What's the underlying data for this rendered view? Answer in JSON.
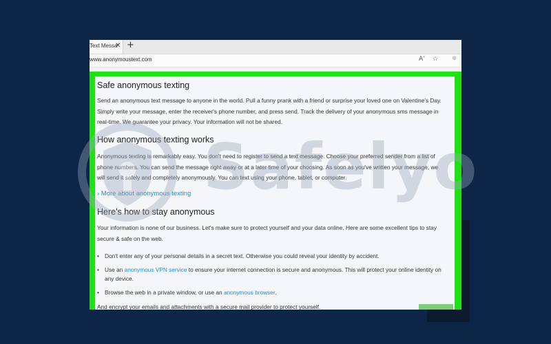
{
  "browser": {
    "tab_title": "Text Messa",
    "tab_close": "✕",
    "new_tab": "+",
    "url": "www.anonymoustext.com",
    "read_aloud_icon": "Aʼ",
    "favorite_icon": "☆",
    "profile_icon": "⌾"
  },
  "page": {
    "h1": "Safe anonymous texting",
    "p1": "Send an anonymous text message to anyone in the world. Pull a funny prank with a friend or surprise your loved one on Valentine's Day. Simply write your message, enter the receiver's phone number, and press send. Track the delivery of your anonymous sms message in real-time. We guarantee your privacy. Your information will not be shared.",
    "h2": "How anonymous texting works",
    "p2": "Anonymous texting is remarkably easy. You don't need to register to send a text message. Choose your preferred sender from a list of phone numbers. You can send the message right away or at a later time of your choosing. As soon as you've written your message, we will send it safely and completely anonymously. You can text using your phone, tablet, or computer.",
    "more_link": "› More about anonymous texting",
    "h3": "Here's how to stay anonymous",
    "p3": "Your information is none of our business. Let's make sure to protect yourself and your data online. Here are some excellent tips to stay secure & safe on the web.",
    "bullet_symbol": "•",
    "bullet1": "Don't enter any of your personal details in a secret text. Otherwise you could reveal your identity by accident.",
    "bullet2_pre": "Use an ",
    "bullet2_link": "anonymous VPN service",
    "bullet2_post": " to ensure your internet connection is secure and anonymous. This will protect your online identity on any device.",
    "bullet3_pre": "Browse the web in a private window, or use an ",
    "bullet3_link": "anonymous browser",
    "bullet3_post": ".",
    "bullet4_cut": "And encrypt your emails and attachments with a secure mail provider to protect yourself."
  },
  "watermark": {
    "text": "Safelyo"
  },
  "colors": {
    "background": "#0d2647",
    "frame_highlight": "#22e016",
    "link": "#1d8fcf"
  }
}
